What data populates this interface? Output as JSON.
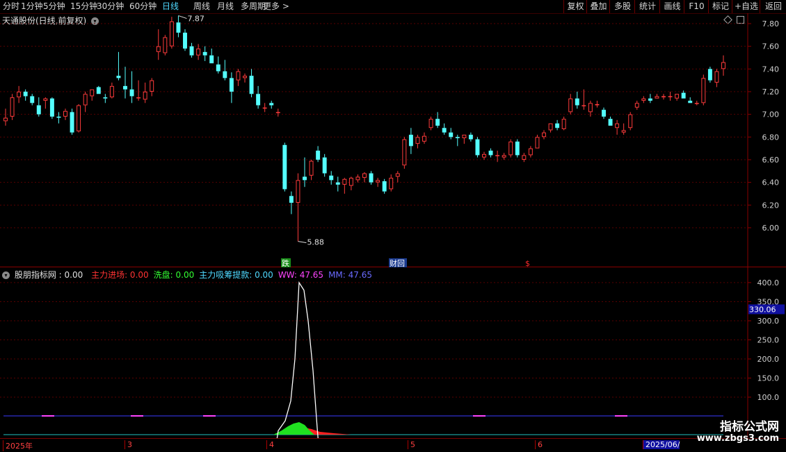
{
  "toolbar": {
    "left": [
      "分时",
      "1分钟",
      "5分钟",
      "15分钟",
      "30分钟",
      "60分钟",
      "日线",
      "周线",
      "月线",
      "多周期",
      "更多 >"
    ],
    "active_index": 6,
    "right": [
      "复权",
      "叠加",
      "多股",
      "统计",
      "画线",
      "F10",
      "标记",
      "+自选",
      "返回"
    ]
  },
  "main_chart": {
    "title": "天通股份(日线,前复权)",
    "y_ticks": [
      "7.80",
      "7.60",
      "7.40",
      "7.20",
      "7.00",
      "6.80",
      "6.60",
      "6.40",
      "6.20",
      "6.00"
    ],
    "high_label": "7.87",
    "low_label": "5.88",
    "markers": [
      {
        "text": "跌",
        "color": "#ffffff",
        "bg": "#1a8f1a"
      },
      {
        "text": "财回",
        "color": "#ffffff",
        "bg": "#1a3a8f"
      },
      {
        "text": "$",
        "color": "#ff2a2a",
        "bg": ""
      }
    ]
  },
  "indicator": {
    "name": "股朋指标网",
    "name_value": ": 0.00",
    "items": [
      {
        "label": "主力进场: 0.00",
        "color": "#ff3333"
      },
      {
        "label": "洗盘: 0.00",
        "color": "#33ff33"
      },
      {
        "label": "主力吸筹提款: 0.00",
        "color": "#4fd9ff"
      },
      {
        "label": "WW: 47.65",
        "color": "#ff44ff"
      },
      {
        "label": "MM: 47.65",
        "color": "#6a6aff"
      }
    ],
    "y_ticks": [
      "400.0",
      "350.0",
      "300.0",
      "250.0",
      "200.0",
      "150.0",
      "100.0"
    ],
    "current_value": "330.06"
  },
  "time_axis": {
    "labels": [
      "2025年",
      "3",
      "4",
      "5",
      "6",
      "2025/06/"
    ]
  },
  "watermark": {
    "title": "指标公式网",
    "url": "www.zbgs3.com"
  },
  "chart_data": {
    "type": "candlestick",
    "ylim": [
      5.85,
      7.95
    ],
    "candles": [
      [
        6.94,
        7.05,
        6.9,
        6.97
      ],
      [
        6.98,
        7.18,
        6.95,
        7.15
      ],
      [
        7.15,
        7.25,
        7.1,
        7.2
      ],
      [
        7.2,
        7.22,
        7.12,
        7.16
      ],
      [
        7.16,
        7.18,
        7.08,
        7.1
      ],
      [
        7.08,
        7.15,
        6.98,
        7.0
      ],
      [
        7.12,
        7.15,
        7.05,
        7.14
      ],
      [
        7.14,
        7.15,
        6.96,
        6.98
      ],
      [
        6.98,
        7.02,
        6.92,
        6.97
      ],
      [
        6.98,
        7.05,
        6.95,
        7.03
      ],
      [
        7.02,
        7.05,
        6.82,
        6.84
      ],
      [
        6.85,
        7.09,
        6.84,
        7.08
      ],
      [
        7.08,
        7.2,
        7.02,
        7.18
      ],
      [
        7.16,
        7.22,
        7.12,
        7.22
      ],
      [
        7.24,
        7.25,
        7.18,
        7.18
      ],
      [
        7.15,
        7.18,
        7.1,
        7.14
      ],
      [
        7.15,
        7.28,
        7.14,
        7.25
      ],
      [
        7.34,
        7.55,
        7.3,
        7.32
      ],
      [
        7.25,
        7.42,
        7.14,
        7.22
      ],
      [
        7.22,
        7.38,
        7.1,
        7.16
      ],
      [
        7.15,
        7.3,
        7.12,
        7.15
      ],
      [
        7.13,
        7.28,
        7.1,
        7.2
      ],
      [
        7.2,
        7.32,
        7.16,
        7.3
      ],
      [
        7.55,
        7.75,
        7.48,
        7.6
      ],
      [
        7.54,
        7.7,
        7.52,
        7.68
      ],
      [
        7.6,
        7.86,
        7.58,
        7.82
      ],
      [
        7.81,
        7.87,
        7.68,
        7.72
      ],
      [
        7.72,
        7.75,
        7.56,
        7.58
      ],
      [
        7.6,
        7.63,
        7.5,
        7.52
      ],
      [
        7.52,
        7.62,
        7.48,
        7.58
      ],
      [
        7.55,
        7.6,
        7.47,
        7.52
      ],
      [
        7.52,
        7.58,
        7.45,
        7.45
      ],
      [
        7.44,
        7.51,
        7.36,
        7.38
      ],
      [
        7.38,
        7.48,
        7.3,
        7.32
      ],
      [
        7.32,
        7.37,
        7.1,
        7.2
      ],
      [
        7.3,
        7.4,
        7.25,
        7.38
      ],
      [
        7.32,
        7.36,
        7.28,
        7.34
      ],
      [
        7.34,
        7.4,
        7.15,
        7.18
      ],
      [
        7.18,
        7.25,
        7.05,
        7.08
      ],
      [
        7.06,
        7.1,
        7.02,
        7.06
      ],
      [
        7.1,
        7.12,
        7.05,
        7.08
      ],
      [
        7.02,
        7.05,
        6.98,
        7.02
      ],
      [
        6.73,
        6.75,
        6.32,
        6.34
      ],
      [
        6.28,
        6.32,
        6.12,
        6.22
      ],
      [
        6.22,
        6.48,
        5.88,
        6.42
      ],
      [
        6.45,
        6.62,
        6.36,
        6.42
      ],
      [
        6.46,
        6.6,
        6.42,
        6.59
      ],
      [
        6.68,
        6.72,
        6.58,
        6.6
      ],
      [
        6.62,
        6.65,
        6.45,
        6.48
      ],
      [
        6.46,
        6.5,
        6.38,
        6.42
      ],
      [
        6.4,
        6.45,
        6.32,
        6.38
      ],
      [
        6.38,
        6.44,
        6.3,
        6.43
      ],
      [
        6.37,
        6.45,
        6.33,
        6.44
      ],
      [
        6.42,
        6.47,
        6.4,
        6.45
      ],
      [
        6.44,
        6.49,
        6.4,
        6.48
      ],
      [
        6.48,
        6.5,
        6.38,
        6.4
      ],
      [
        6.4,
        6.44,
        6.36,
        6.42
      ],
      [
        6.41,
        6.43,
        6.3,
        6.32
      ],
      [
        6.34,
        6.47,
        6.32,
        6.44
      ],
      [
        6.45,
        6.5,
        6.4,
        6.48
      ],
      [
        6.55,
        6.8,
        6.52,
        6.78
      ],
      [
        6.82,
        6.88,
        6.65,
        6.72
      ],
      [
        6.74,
        6.82,
        6.7,
        6.8
      ],
      [
        6.76,
        6.84,
        6.74,
        6.81
      ],
      [
        6.88,
        6.98,
        6.86,
        6.96
      ],
      [
        6.96,
        7.02,
        6.88,
        6.9
      ],
      [
        6.88,
        6.92,
        6.82,
        6.84
      ],
      [
        6.84,
        6.88,
        6.78,
        6.8
      ],
      [
        6.8,
        6.82,
        6.72,
        6.79
      ],
      [
        6.79,
        6.82,
        6.74,
        6.82
      ],
      [
        6.82,
        6.84,
        6.76,
        6.78
      ],
      [
        6.78,
        6.8,
        6.62,
        6.64
      ],
      [
        6.62,
        6.67,
        6.6,
        6.65
      ],
      [
        6.68,
        6.7,
        6.62,
        6.64
      ],
      [
        6.64,
        6.68,
        6.58,
        6.64
      ],
      [
        6.62,
        6.66,
        6.6,
        6.64
      ],
      [
        6.64,
        6.78,
        6.62,
        6.76
      ],
      [
        6.76,
        6.78,
        6.62,
        6.64
      ],
      [
        6.6,
        6.66,
        6.58,
        6.64
      ],
      [
        6.64,
        6.72,
        6.62,
        6.7
      ],
      [
        6.7,
        6.82,
        6.7,
        6.8
      ],
      [
        6.8,
        6.86,
        6.78,
        6.84
      ],
      [
        6.86,
        6.92,
        6.84,
        6.92
      ],
      [
        6.92,
        6.95,
        6.86,
        6.88
      ],
      [
        6.87,
        6.98,
        6.86,
        6.96
      ],
      [
        7.02,
        7.18,
        7.0,
        7.14
      ],
      [
        7.14,
        7.2,
        7.05,
        7.08
      ],
      [
        7.08,
        7.22,
        7.04,
        7.08
      ],
      [
        7.02,
        7.12,
        6.98,
        7.1
      ],
      [
        7.08,
        7.12,
        7.06,
        7.09
      ],
      [
        7.04,
        7.06,
        6.96,
        6.98
      ],
      [
        6.96,
        6.98,
        6.9,
        6.9
      ],
      [
        6.88,
        6.95,
        6.82,
        6.92
      ],
      [
        6.84,
        6.92,
        6.82,
        6.86
      ],
      [
        6.88,
        7.02,
        6.86,
        7.0
      ],
      [
        7.06,
        7.12,
        7.04,
        7.1
      ],
      [
        7.12,
        7.16,
        7.1,
        7.14
      ],
      [
        7.14,
        7.18,
        7.1,
        7.12
      ],
      [
        7.14,
        7.18,
        7.14,
        7.16
      ],
      [
        7.15,
        7.18,
        7.13,
        7.16
      ],
      [
        7.16,
        7.2,
        7.12,
        7.16
      ],
      [
        7.14,
        7.18,
        7.12,
        7.18
      ],
      [
        7.19,
        7.21,
        7.14,
        7.14
      ],
      [
        7.12,
        7.15,
        7.1,
        7.1
      ],
      [
        7.1,
        7.12,
        7.08,
        7.1
      ],
      [
        7.1,
        7.35,
        7.08,
        7.32
      ],
      [
        7.4,
        7.42,
        7.28,
        7.3
      ],
      [
        7.28,
        7.4,
        7.24,
        7.38
      ],
      [
        7.4,
        7.52,
        7.34,
        7.46
      ]
    ],
    "indicator_white_line": [
      [
        393,
        0
      ],
      [
        400,
        12
      ],
      [
        410,
        38
      ],
      [
        418,
        90
      ],
      [
        424,
        200
      ],
      [
        430,
        400
      ],
      [
        437,
        380
      ],
      [
        443,
        300
      ],
      [
        450,
        170
      ],
      [
        456,
        20
      ],
      [
        460,
        0
      ]
    ],
    "green_bar": [
      [
        393,
        0
      ],
      [
        405,
        6
      ],
      [
        414,
        12
      ],
      [
        422,
        16
      ],
      [
        430,
        18
      ],
      [
        438,
        14
      ],
      [
        445,
        6
      ],
      [
        452,
        0
      ]
    ],
    "red_bar": [
      [
        430,
        0
      ],
      [
        438,
        10
      ],
      [
        448,
        8
      ],
      [
        460,
        4
      ],
      [
        480,
        2
      ],
      [
        505,
        0
      ]
    ]
  }
}
